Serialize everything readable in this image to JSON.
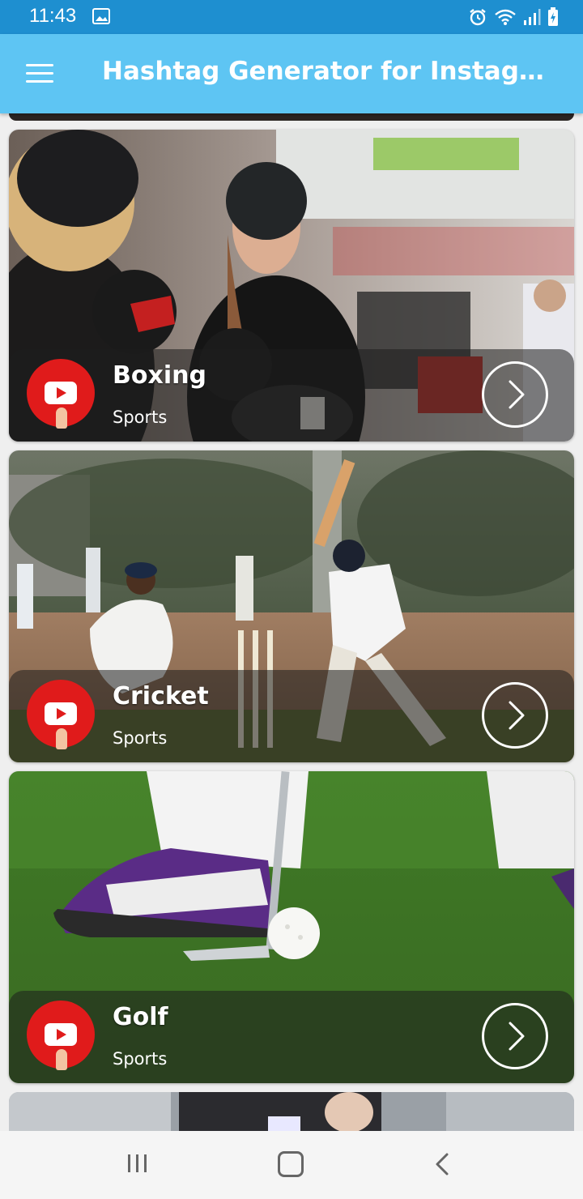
{
  "status_bar": {
    "time": "11:43"
  },
  "app_bar": {
    "title": "Hashtag Generator for Instagram..."
  },
  "cards": [
    {
      "title": "Boxing",
      "category": "Sports"
    },
    {
      "title": "Cricket",
      "category": "Sports"
    },
    {
      "title": "Golf",
      "category": "Sports"
    }
  ],
  "colors": {
    "status_bar": "#1e8fd0",
    "app_bar": "#5ec5f3",
    "youtube_red": "#e01b1b"
  },
  "icons": [
    "menu-icon",
    "youtube-icon",
    "chevron-right-icon",
    "alarm-icon",
    "wifi-icon",
    "signal-icon",
    "battery-icon"
  ]
}
